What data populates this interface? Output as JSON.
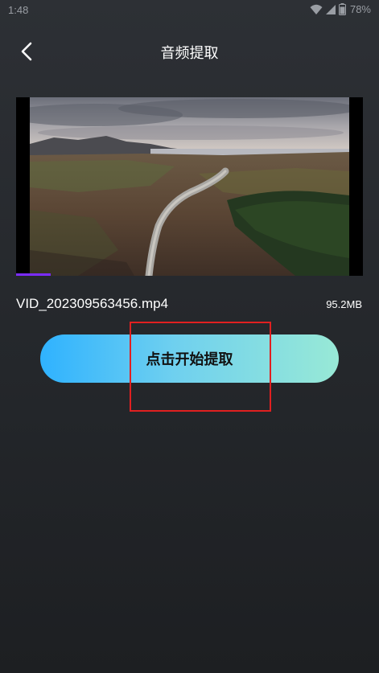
{
  "status_bar": {
    "time": "1:48",
    "battery": "78%"
  },
  "header": {
    "title": "音频提取",
    "back_icon": "chevron-left-icon"
  },
  "video": {
    "progress": 0.1
  },
  "file": {
    "name": "VID_202309563456.mp4",
    "size": "95.2MB"
  },
  "actions": {
    "extract_label": "点击开始提取"
  },
  "colors": {
    "accent_start": "#2fb2ff",
    "accent_end": "#98e9d6",
    "progress": "#7b2cff",
    "highlight": "#e02020"
  }
}
